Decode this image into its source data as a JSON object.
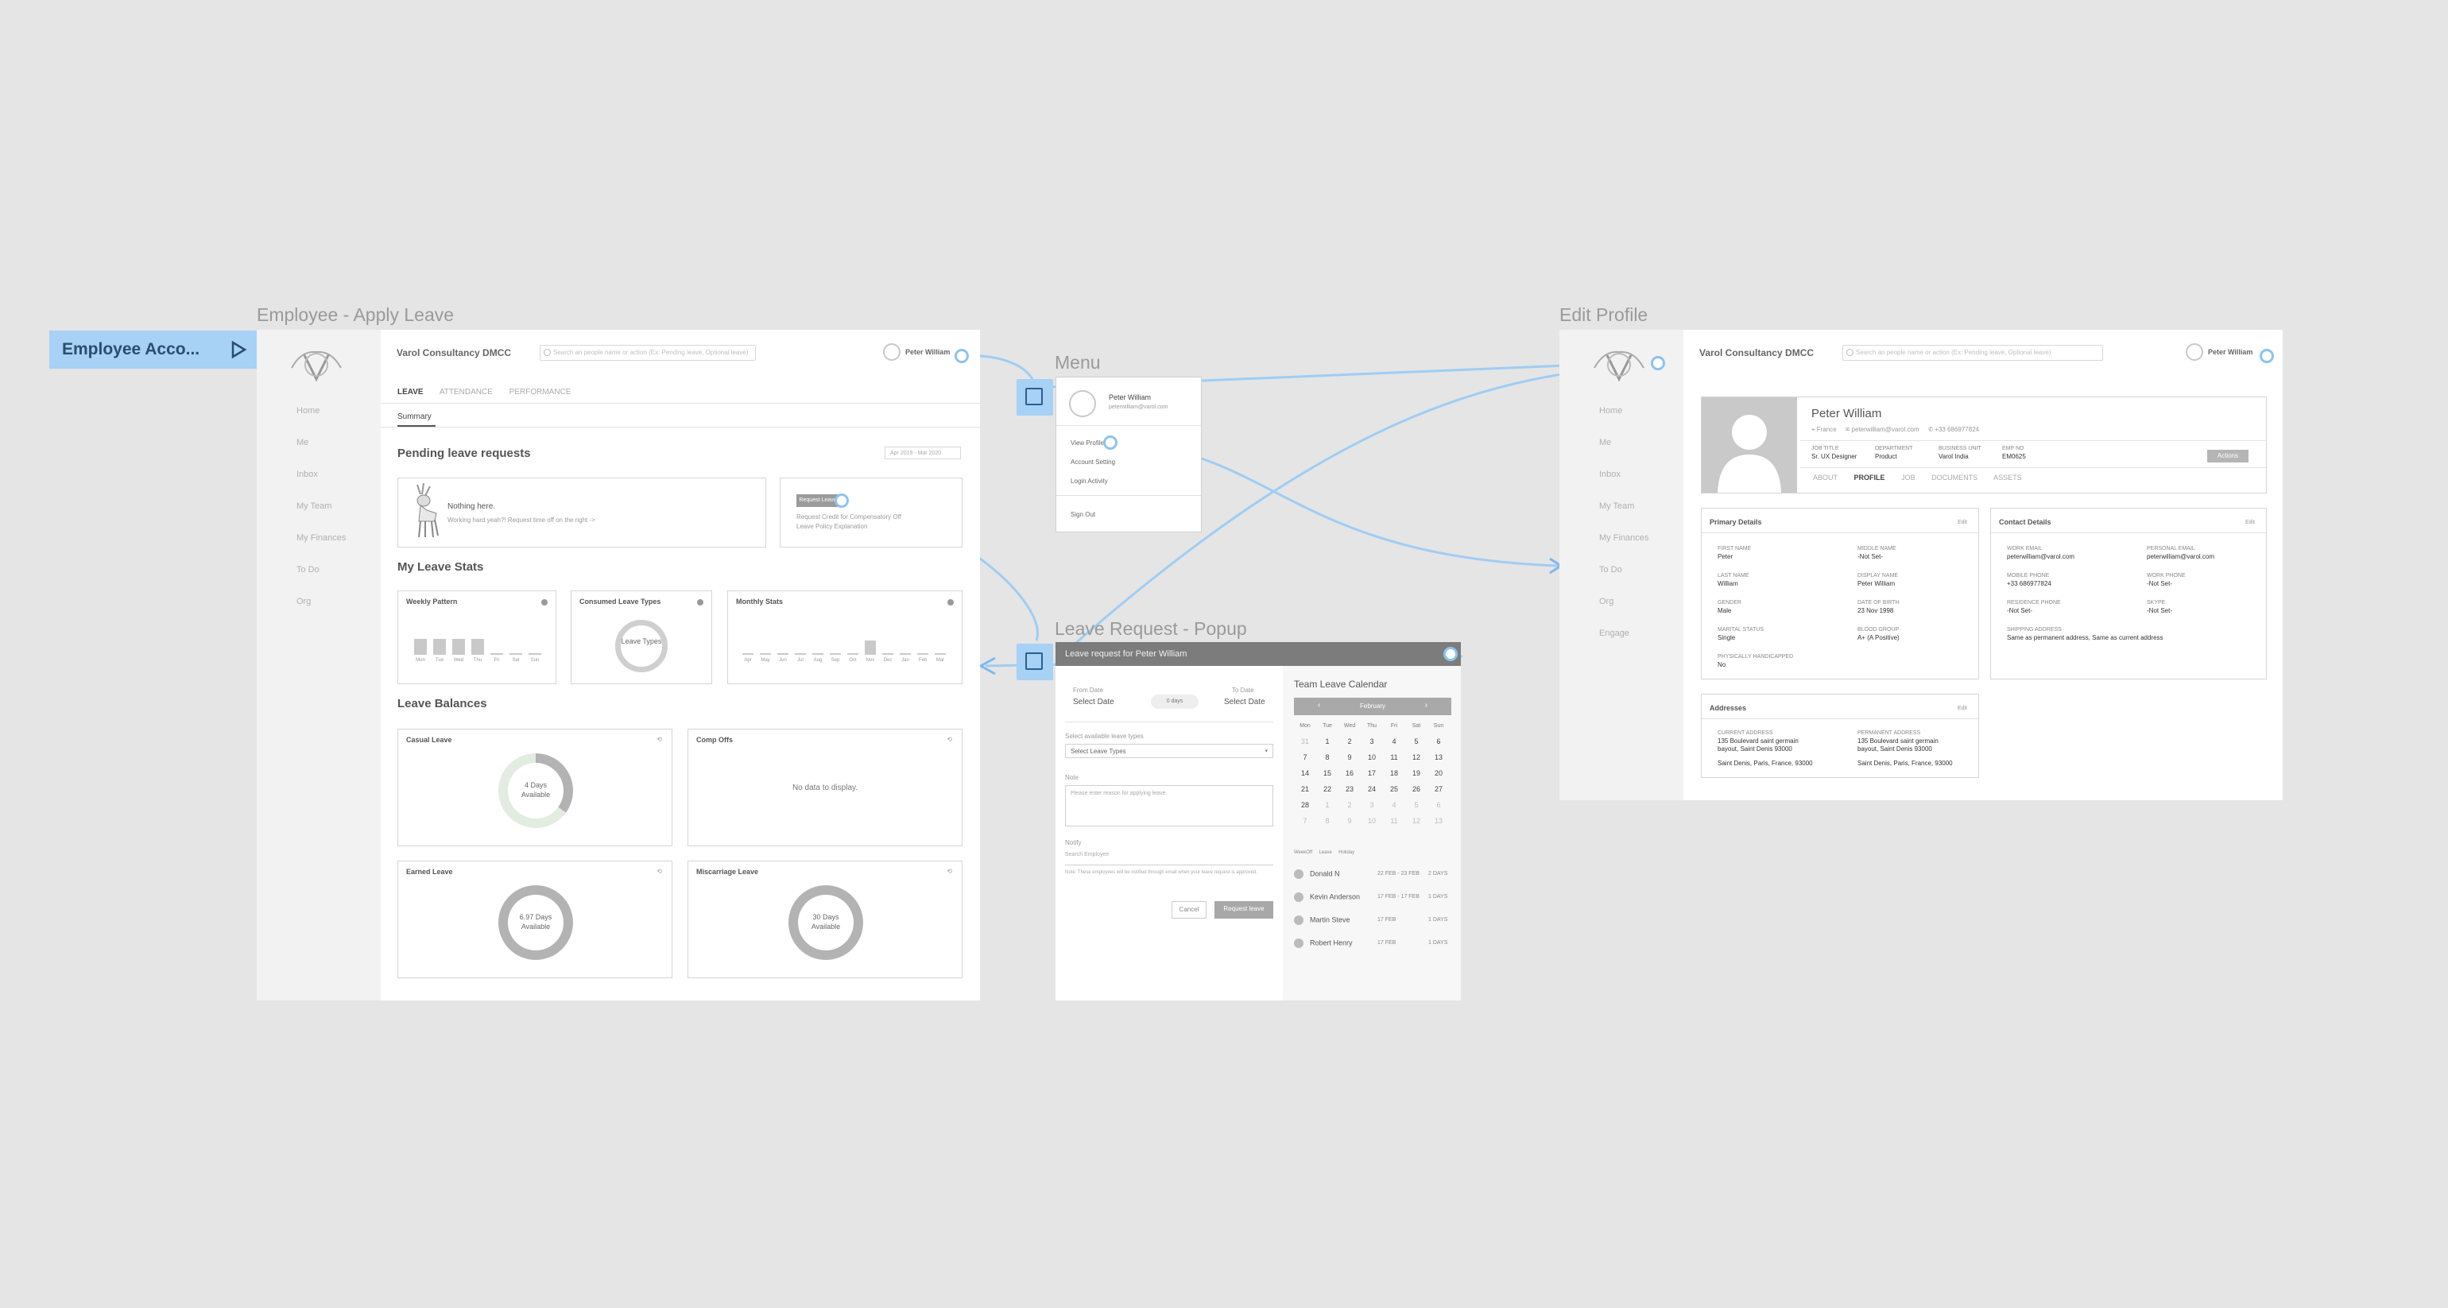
{
  "flow_badge": {
    "label": "Employee Acco..."
  },
  "frames": {
    "apply_leave": "Employee - Apply Leave",
    "menu": "Menu",
    "leave_popup": "Leave Request - Popup",
    "edit_profile": "Edit Profile"
  },
  "app": {
    "company": "Varol Consultancy DMCC",
    "search_placeholder": "Search an people name or action (Ex: Pending leave, Optional leave)",
    "user_name": "Peter William"
  },
  "sidebar": [
    "Home",
    "Me",
    "Inbox",
    "My Team",
    "My Finances",
    "To Do",
    "Org"
  ],
  "sidebar_profile": [
    "Home",
    "Me",
    "Inbox",
    "My Team",
    "My Finances",
    "To Do",
    "Org",
    "Engage"
  ],
  "apply_leave": {
    "tabs": [
      "LEAVE",
      "ATTENDANCE",
      "PERFORMANCE"
    ],
    "subtab": "Summary",
    "pending_title": "Pending leave requests",
    "date_range": "Apr 2019 - Mar 2020",
    "nothing_here": "Nothing here.",
    "nothing_sub": "Working hard yeah?! Request time off on the right ->",
    "request_badge": "Request Leave",
    "request_links": [
      "Request Credit for Compensatory Off",
      "Leave Policy Explanation"
    ],
    "stats_title": "My Leave Stats",
    "weekly_title": "Weekly Pattern",
    "weekly_days": [
      "Mon",
      "Tue",
      "Wed",
      "Thu",
      "Fri",
      "Sat",
      "Sun"
    ],
    "consumed_title": "Consumed Leave Types",
    "consumed_center": "Leave Types",
    "monthly_title": "Monthly Stats",
    "monthly_months": [
      "Apr",
      "May",
      "Jun",
      "Jul",
      "Aug",
      "Sep",
      "Oct",
      "Nov",
      "Dec",
      "Jan",
      "Feb",
      "Mar"
    ],
    "balances_title": "Leave Balances",
    "balances": [
      {
        "name": "Casual Leave",
        "value": "4 Days Available",
        "fill": 0.35
      },
      {
        "name": "Comp Offs",
        "value": "No data to display."
      },
      {
        "name": "Earned Leave",
        "value": "6.97 Days Available",
        "fill": 1
      },
      {
        "name": "Miscarriage Leave",
        "value": "30 Days Available",
        "fill": 1
      }
    ]
  },
  "menu": {
    "name": "Peter William",
    "email": "peterwilliam@varol.com",
    "items": [
      "View Profile",
      "Account Setting",
      "Login Activity"
    ],
    "signout": "Sign Out"
  },
  "popup": {
    "header": "Leave request for Peter William",
    "from_label": "From Date",
    "from_value": "Select Date",
    "days": "0 days",
    "to_label": "To Date",
    "to_value": "Select Date",
    "type_label": "Select available leave types",
    "type_value": "Select Leave Types",
    "note_label": "Note",
    "note_placeholder": "Please enter reason for applying leave.",
    "notify_label": "Notify",
    "notify_placeholder": "Search Employee",
    "notify_hint": "Note: These employees will be notified through email when your leave request is approved.",
    "cancel": "Cancel",
    "submit": "Request leave",
    "calendar_title": "Team Leave Calendar",
    "month": "February",
    "weekdays": [
      "Mon",
      "Tue",
      "Wed",
      "Thu",
      "Fri",
      "Sat",
      "Sun"
    ],
    "weeks": [
      [
        "31",
        "1",
        "2",
        "3",
        "4",
        "5",
        "6"
      ],
      [
        "7",
        "8",
        "9",
        "10",
        "11",
        "12",
        "13"
      ],
      [
        "14",
        "15",
        "16",
        "17",
        "18",
        "19",
        "20"
      ],
      [
        "21",
        "22",
        "23",
        "24",
        "25",
        "26",
        "27"
      ],
      [
        "28",
        "1",
        "2",
        "3",
        "4",
        "5",
        "6"
      ],
      [
        "7",
        "8",
        "9",
        "10",
        "11",
        "12",
        "13"
      ]
    ],
    "legend": [
      "WeekOff",
      "Leave",
      "Holiday"
    ],
    "members": [
      {
        "name": "Donald N",
        "dates": "22 FEB - 23 FEB",
        "count": "2 DAYS"
      },
      {
        "name": "Kevin Anderson",
        "dates": "17 FEB - 17 FEB",
        "count": "1 DAYS"
      },
      {
        "name": "Martin Steve",
        "dates": "17 FEB",
        "count": "1 DAYS"
      },
      {
        "name": "Robert Henry",
        "dates": "17 FEB",
        "count": "1 DAYS"
      }
    ]
  },
  "profile": {
    "name": "Peter William",
    "location": "France",
    "email": "peterwilliam@varol.com",
    "phone": "+33 686977824",
    "fields": [
      {
        "label": "JOB TITLE",
        "value": "Sr. UX Designer"
      },
      {
        "label": "DEPARTMENT",
        "value": "Product"
      },
      {
        "label": "BUSINESS UNIT",
        "value": "Varol India"
      },
      {
        "label": "EMP NO",
        "value": "EM0625"
      }
    ],
    "actions": "Actions",
    "tabs": [
      "ABOUT",
      "PROFILE",
      "JOB",
      "DOCUMENTS",
      "ASSETS"
    ],
    "primary_title": "Primary Details",
    "primary_action": "Edit",
    "primary": [
      {
        "label": "FIRST NAME",
        "value": "Peter"
      },
      {
        "label": "MIDDLE NAME",
        "value": "-Not Set-"
      },
      {
        "label": "LAST NAME",
        "value": "William"
      },
      {
        "label": "DISPLAY NAME",
        "value": "Peter William"
      },
      {
        "label": "GENDER",
        "value": "Male"
      },
      {
        "label": "DATE OF BIRTH",
        "value": "23 Nov 1998"
      },
      {
        "label": "MARITAL STATUS",
        "value": "Single"
      },
      {
        "label": "BLOOD GROUP",
        "value": "A+ (A Positive)"
      },
      {
        "label": "PHYSICALLY HANDICAPPED",
        "value": "No"
      }
    ],
    "contact_title": "Contact Details",
    "contact_action": "Edit",
    "contact": [
      {
        "label": "WORK EMAIL",
        "value": "peterwilliam@varol.com"
      },
      {
        "label": "PERSONAL EMAIL",
        "value": "peterwilliam@varol.com"
      },
      {
        "label": "MOBILE PHONE",
        "value": "+33 686977824"
      },
      {
        "label": "WORK PHONE",
        "value": "-Not Set-"
      },
      {
        "label": "RESIDENCE PHONE",
        "value": "-Not Set-"
      },
      {
        "label": "SKYPE",
        "value": "-Not Set-"
      },
      {
        "label": "SHIPPING ADDRESS",
        "value": "Same as permanent address, Same as current address"
      }
    ],
    "address_title": "Addresses",
    "address_action": "Edit",
    "addresses": [
      {
        "label": "CURRENT ADDRESS",
        "line1": "135 Boulevard saint germain",
        "line2": "bayout, Saint Denis 93000",
        "line3": "Saint Denis, Paris, France, 93000"
      },
      {
        "label": "PERMANENT ADDRESS",
        "line1": "135 Boulevard saint germain",
        "line2": "bayout, Saint Denis 93000",
        "line3": "Saint Denis, Paris, France, 93000"
      }
    ]
  }
}
